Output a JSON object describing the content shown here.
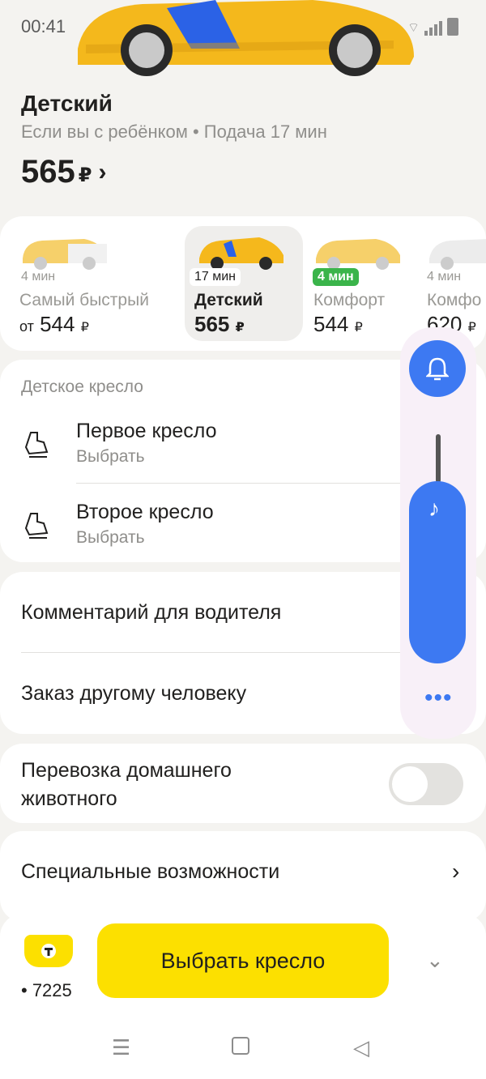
{
  "status_bar": {
    "time": "00:41"
  },
  "tariff": {
    "title": "Детский",
    "subtitle": "Если вы с ребёнком • Подача 17 мин",
    "price": "565",
    "currency": "₽"
  },
  "tariffs": [
    {
      "eta": "4 мин",
      "name": "Самый быстрый",
      "price_prefix": "от",
      "price": "544",
      "currency": "₽"
    },
    {
      "eta": "17 мин",
      "name": "Детский",
      "price_prefix": "",
      "price": "565",
      "currency": "₽",
      "selected": true
    },
    {
      "eta": "4 мин",
      "name": "Комфорт",
      "price_prefix": "",
      "price": "544",
      "currency": "₽",
      "eta_highlight": true
    },
    {
      "eta": "4 мин",
      "name": "Комфо",
      "price_prefix": "",
      "price": "620",
      "currency": "₽"
    }
  ],
  "child_seat": {
    "section_label": "Детское кресло",
    "items": [
      {
        "title": "Первое кресло",
        "subtitle": "Выбрать"
      },
      {
        "title": "Второе кресло",
        "subtitle": "Выбрать"
      }
    ]
  },
  "options": {
    "comment": "Комментарий для водителя",
    "other_person": "Заказ другому человеку",
    "pet": "Перевозка домашнего животного",
    "pet_enabled": false,
    "accessibility": "Специальные возможности"
  },
  "bottom_bar": {
    "payment_last4": "• 7225",
    "main_button": "Выбрать кресло"
  },
  "colors": {
    "brand_yellow": "#fce000",
    "accent_blue": "#3d79f2",
    "eta_green": "#3ab44a"
  }
}
